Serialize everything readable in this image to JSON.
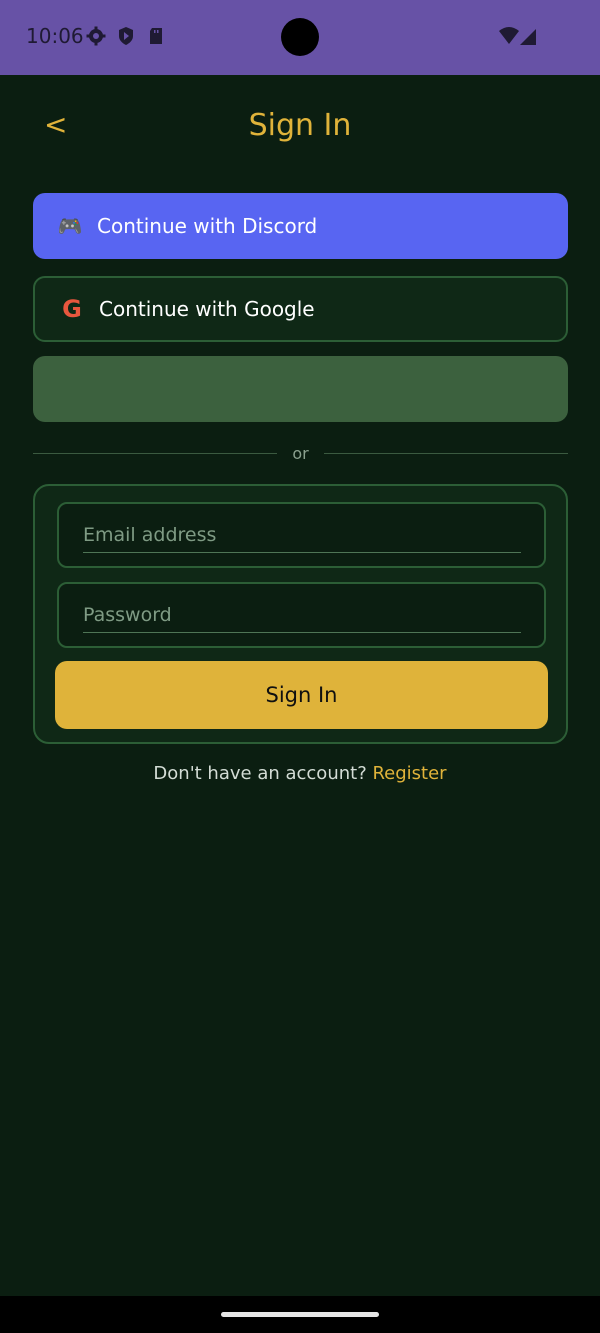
{
  "status_bar": {
    "time": "10:06",
    "icons": [
      "gear-icon",
      "shield-icon",
      "sd-card-icon",
      "wifi-icon",
      "signal-icon"
    ]
  },
  "header": {
    "back_label": "<",
    "title": "Sign In"
  },
  "social": {
    "discord_label": "Continue with Discord",
    "discord_icon": "🎮",
    "google_label": "Continue with Google",
    "google_icon": "G"
  },
  "divider": {
    "label": "or"
  },
  "form": {
    "email": {
      "value": "",
      "placeholder": "Email address"
    },
    "password": {
      "value": "",
      "placeholder": "Password"
    },
    "submit_label": "Sign In"
  },
  "footer": {
    "prompt": "Don't have an account? ",
    "register_label": "Register"
  },
  "colors": {
    "background": "#0b1e11",
    "status_bar": "#6752a6",
    "accent": "#e0b33a",
    "discord": "#5865f2",
    "border": "#2c5e36"
  }
}
